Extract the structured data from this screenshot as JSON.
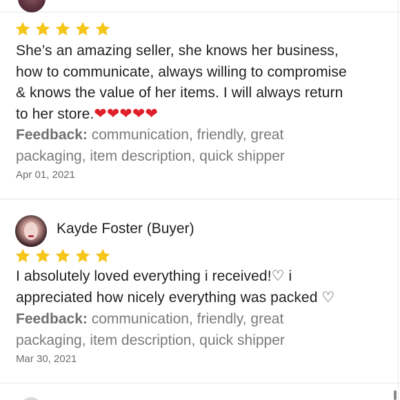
{
  "review1": {
    "rating": 5,
    "text_line1": "She’s an amazing seller, she knows her business,",
    "text_line2": "how to communicate, always willing to compromise",
    "text_line3": "& knows the value of her items. I will always return",
    "text_line4": "to her store.",
    "hearts": "❤❤❤❤❤",
    "feedback_label": "Feedback:",
    "feedback_line1": "communication, friendly, great",
    "feedback_line2": "packaging, item description, quick shipper",
    "date": "Apr 01, 2021"
  },
  "review2": {
    "reviewer": "Kayde Foster (Buyer)",
    "rating": 5,
    "text_line1": "I absolutely  loved  everything  i received!♡ i",
    "text_line2": "appreciated how nicely everything was packed ♡",
    "feedback_label": "Feedback:",
    "feedback_line1": "communication, friendly, great",
    "feedback_line2": "packaging, item description, quick shipper",
    "date": "Mar 30, 2021"
  },
  "colors": {
    "star": "#f5c518",
    "divider": "#e6e6e6",
    "feedback_text": "#7a7a7a",
    "heart": "#e0202a"
  },
  "icons": {
    "star": "star-icon",
    "avatar": "avatar"
  }
}
